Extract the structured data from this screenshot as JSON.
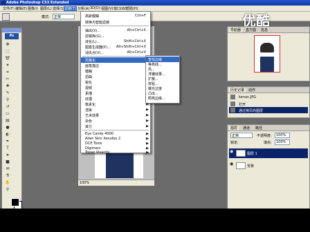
{
  "window": {
    "title": "Adobe Photoshop CS3 Extended"
  },
  "menubar": {
    "items": [
      "文件(F)",
      "编辑(E)",
      "图像(I)",
      "图层(L)",
      "选择(S)",
      "滤镜(T)",
      "分析(A)",
      "3D(D)",
      "视图(V)",
      "窗口(W)",
      "帮助(H)"
    ],
    "active_index": 5
  },
  "options": {
    "mode_label": "模式:",
    "mode_value": "正常"
  },
  "watermark": "优酷",
  "filter_menu": {
    "items": [
      {
        "label": "高斯模糊",
        "shortcut": "Ctrl+F"
      },
      {
        "label": "转换为智能滤镜",
        "shortcut": ""
      },
      {
        "label": "抽出(X)...",
        "shortcut": "Alt+Ctrl+X"
      },
      {
        "label": "滤镜库(G)...",
        "shortcut": ""
      },
      {
        "label": "液化(L)...",
        "shortcut": "Shift+Ctrl+X"
      },
      {
        "label": "图案生成器(P)...",
        "shortcut": "Alt+Shift+Ctrl+X"
      },
      {
        "label": "消失点(V)...",
        "shortcut": "Alt+Ctrl+V"
      },
      {
        "label": "风格化",
        "shortcut": ""
      },
      {
        "label": "画笔描边",
        "shortcut": ""
      },
      {
        "label": "模糊",
        "shortcut": ""
      },
      {
        "label": "扭曲",
        "shortcut": ""
      },
      {
        "label": "锐化",
        "shortcut": ""
      },
      {
        "label": "视频",
        "shortcut": ""
      },
      {
        "label": "素描",
        "shortcut": ""
      },
      {
        "label": "纹理",
        "shortcut": ""
      },
      {
        "label": "像素化",
        "shortcut": ""
      },
      {
        "label": "渲染",
        "shortcut": ""
      },
      {
        "label": "艺术效果",
        "shortcut": ""
      },
      {
        "label": "杂色",
        "shortcut": ""
      },
      {
        "label": "其它",
        "shortcut": ""
      },
      {
        "label": "Eye Candy 4000",
        "shortcut": ""
      },
      {
        "label": "Alien Skin Xenofex 2",
        "shortcut": ""
      },
      {
        "label": "DCE Tools",
        "shortcut": ""
      },
      {
        "label": "Digimarc",
        "shortcut": ""
      },
      {
        "label": "Topaz Vivacity",
        "shortcut": ""
      }
    ],
    "highlighted_index": 7
  },
  "submenu": {
    "items": [
      "查找边缘",
      "等高线...",
      "风...",
      "浮雕效果...",
      "扩散...",
      "拼贴...",
      "曝光过度",
      "凸出...",
      "照亮边缘..."
    ],
    "highlighted_index": 0
  },
  "document": {
    "zoom": "100%"
  },
  "navigator": {
    "tabs": [
      "导航器",
      "直方图",
      "信息"
    ]
  },
  "history": {
    "tabs": [
      "历史记录",
      "动作"
    ],
    "snapshot": "kenan.JPG",
    "items": [
      "打开",
      "通过拷贝的图层"
    ]
  },
  "layers": {
    "tabs": [
      "图层",
      "通道",
      "路径"
    ],
    "blend_mode": "正常",
    "opacity_label": "不透明度:",
    "opacity_value": "100%",
    "lock_label": "锁定:",
    "fill_label": "填充:",
    "fill_value": "100%",
    "items": [
      "图层 1",
      "背景"
    ]
  },
  "colors": {
    "menu_highlight": "#316ac5",
    "layer_selected": "#0a246a",
    "titlebar": "#0b3aa8"
  }
}
